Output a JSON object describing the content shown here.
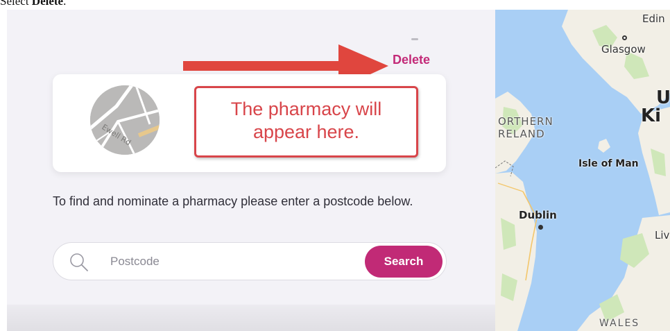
{
  "caption": {
    "prefix": "Select ",
    "emphasis": "Delete",
    "suffix": "."
  },
  "pharmacy": {
    "delete_label": "Delete",
    "callout_text": "The pharmacy will appear here.",
    "map_thumb_road_label": "Ewell Rd"
  },
  "instruction_text": "To find and nominate a pharmacy please enter a postcode below.",
  "search": {
    "placeholder": "Postcode",
    "button_label": "Search"
  },
  "map": {
    "labels": {
      "edin": "Edin",
      "glasgow": "Glasgow",
      "uk_line1": "U",
      "uk_line2": "Ki",
      "northern_ireland_line1": "ORTHERN",
      "northern_ireland_line2": "RELAND",
      "isle_of_man": "Isle of Man",
      "dublin": "Dublin",
      "liverpool": "Liv",
      "wales": "WALES"
    }
  },
  "colors": {
    "accent": "#c12a76",
    "callout": "#d8454a",
    "arrow": "#e0463e",
    "sea": "#a9cff5",
    "land": "#f2efe6",
    "panel_bg": "#f3f2f7"
  },
  "icons": {
    "search": "search-icon",
    "arrow": "right-arrow-annotation"
  }
}
